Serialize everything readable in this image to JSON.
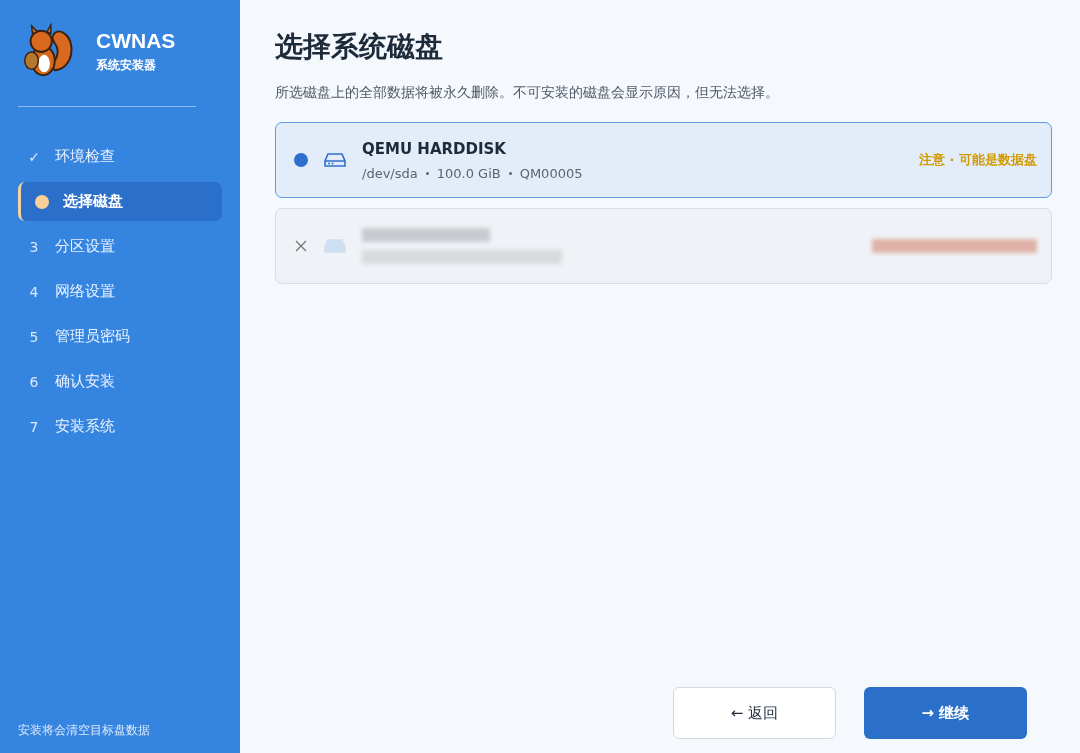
{
  "brand": {
    "name": "CWNAS",
    "subtitle": "系统安装器"
  },
  "steps": [
    {
      "kind": "done",
      "marker": "✓",
      "label": "环境检查",
      "selected": false
    },
    {
      "kind": "current",
      "label": "选择磁盘",
      "selected": true
    },
    {
      "kind": "pending",
      "marker": "3",
      "label": "分区设置",
      "selected": false
    },
    {
      "kind": "pending",
      "marker": "4",
      "label": "网络设置",
      "selected": false
    },
    {
      "kind": "pending",
      "marker": "5",
      "label": "管理员密码",
      "selected": false
    },
    {
      "kind": "pending",
      "marker": "6",
      "label": "确认安装",
      "selected": false
    },
    {
      "kind": "pending",
      "marker": "7",
      "label": "安装系统",
      "selected": false
    }
  ],
  "sidebar_footer": "安装将会清空目标盘数据",
  "page": {
    "title": "选择系统磁盘",
    "description": "所选磁盘上的全部数据将被永久删除。不可安装的磁盘会显示原因，但无法选择。"
  },
  "disks": [
    {
      "kind": "disk",
      "selected": true,
      "disabled": false,
      "name": "QEMU HARDDISK",
      "details": [
        "/dev/sda",
        "100.0 GiB",
        "QM00005"
      ],
      "warning": "注意 · 可能是数据盘"
    },
    {
      "kind": "redacted",
      "selected": false,
      "disabled": true
    }
  ],
  "buttons": [
    {
      "kind": "back",
      "icon": "←",
      "label": "返回"
    },
    {
      "kind": "next",
      "icon": "→",
      "label": "继续"
    }
  ]
}
